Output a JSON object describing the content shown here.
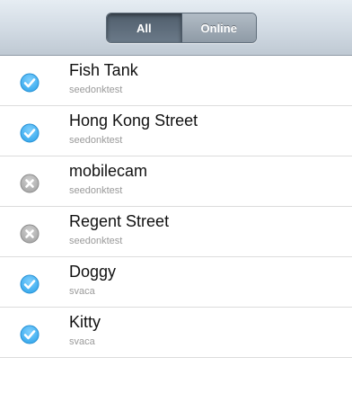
{
  "filter": {
    "tabs": [
      {
        "label": "All",
        "selected": true
      },
      {
        "label": "Online",
        "selected": false
      }
    ]
  },
  "colors": {
    "online": "#38a9ec",
    "offline": "#a7a7a7"
  },
  "cameras": [
    {
      "name": "Fish Tank",
      "owner": "seedonktest",
      "status": "online",
      "icon": "check-circle-icon"
    },
    {
      "name": "Hong Kong Street",
      "owner": "seedonktest",
      "status": "online",
      "icon": "check-circle-icon"
    },
    {
      "name": "mobilecam",
      "owner": "seedonktest",
      "status": "offline",
      "icon": "x-circle-icon"
    },
    {
      "name": "Regent Street",
      "owner": "seedonktest",
      "status": "offline",
      "icon": "x-circle-icon"
    },
    {
      "name": "Doggy",
      "owner": "svaca",
      "status": "online",
      "icon": "check-circle-icon"
    },
    {
      "name": "Kitty",
      "owner": "svaca",
      "status": "online",
      "icon": "check-circle-icon"
    }
  ]
}
